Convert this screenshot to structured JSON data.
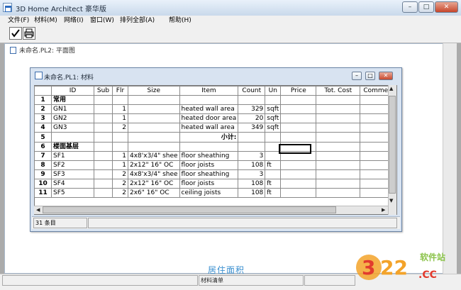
{
  "app": {
    "title": "3D Home Architect 豪华版"
  },
  "window_controls": {
    "minimize": "–",
    "maximize": "□",
    "close": "✕"
  },
  "menu": [
    "文件(F)",
    "材料(M)",
    "网络(I)",
    "窗口(W)",
    "排列全部(A)",
    "帮助(H)"
  ],
  "toolbar": {
    "icons": [
      "check-icon",
      "print-icon"
    ]
  },
  "plan_window": {
    "title": "未命名.PL2: 平面图"
  },
  "materials_window": {
    "title": "未命名.PL1: 材料",
    "columns": [
      "ID",
      "Sub",
      "Flr",
      "Size",
      "Item",
      "Count",
      "Un",
      "Price",
      "Tot. Cost",
      "Comme"
    ],
    "rows": [
      {
        "n": "1",
        "id": "常用",
        "sub": "",
        "flr": "",
        "size": "",
        "item": "",
        "count": "",
        "un": "",
        "price": "",
        "tot": "",
        "comment": ""
      },
      {
        "n": "2",
        "id": "GN1",
        "sub": "",
        "flr": "1",
        "size": "",
        "item": "heated wall area",
        "count": "329",
        "un": "sqft",
        "price": "",
        "tot": "",
        "comment": ""
      },
      {
        "n": "3",
        "id": "GN2",
        "sub": "",
        "flr": "1",
        "size": "",
        "item": "heated door area",
        "count": "20",
        "un": "sqft",
        "price": "",
        "tot": "",
        "comment": ""
      },
      {
        "n": "4",
        "id": "GN3",
        "sub": "",
        "flr": "2",
        "size": "",
        "item": "heated wall area",
        "count": "349",
        "un": "sqft",
        "price": "",
        "tot": "",
        "comment": ""
      },
      {
        "n": "5",
        "id": "",
        "sub": "",
        "flr": "",
        "size": "",
        "item": "小计:",
        "count": "",
        "un": "",
        "price": "",
        "tot": "",
        "comment": ""
      },
      {
        "n": "6",
        "id": "楼面基层",
        "sub": "",
        "flr": "",
        "size": "",
        "item": "",
        "count": "",
        "un": "",
        "price": "",
        "tot": "",
        "comment": ""
      },
      {
        "n": "7",
        "id": "SF1",
        "sub": "",
        "flr": "1",
        "size": "4x8'x3/4\" shee",
        "item": "floor sheathing",
        "count": "3",
        "un": "",
        "price": "",
        "tot": "",
        "comment": ""
      },
      {
        "n": "8",
        "id": "SF2",
        "sub": "",
        "flr": "1",
        "size": "2x12\" 16\" OC",
        "item": "floor joists",
        "count": "108",
        "un": "ft",
        "price": "",
        "tot": "",
        "comment": ""
      },
      {
        "n": "9",
        "id": "SF3",
        "sub": "",
        "flr": "2",
        "size": "4x8'x3/4\" shee",
        "item": "floor sheathing",
        "count": "3",
        "un": "",
        "price": "",
        "tot": "",
        "comment": ""
      },
      {
        "n": "10",
        "id": "SF4",
        "sub": "",
        "flr": "2",
        "size": "2x12\" 16\" OC",
        "item": "floor joists",
        "count": "108",
        "un": "ft",
        "price": "",
        "tot": "",
        "comment": ""
      },
      {
        "n": "11",
        "id": "SF5",
        "sub": "",
        "flr": "2",
        "size": "2x6\" 16\" OC",
        "item": "ceiling joists",
        "count": "108",
        "un": "ft",
        "price": "",
        "tot": "",
        "comment": ""
      }
    ],
    "status": {
      "count_label": "31 条目"
    }
  },
  "bottom_label": "居住面积",
  "status_bar": {
    "label": "材料清单"
  },
  "watermark": {
    "text": "软件站",
    "domain": "322.CC"
  },
  "colors": {
    "accent": "#3a8fd0",
    "title_gradient_top": "#e9f1fa",
    "close_red": "#c7462b"
  }
}
